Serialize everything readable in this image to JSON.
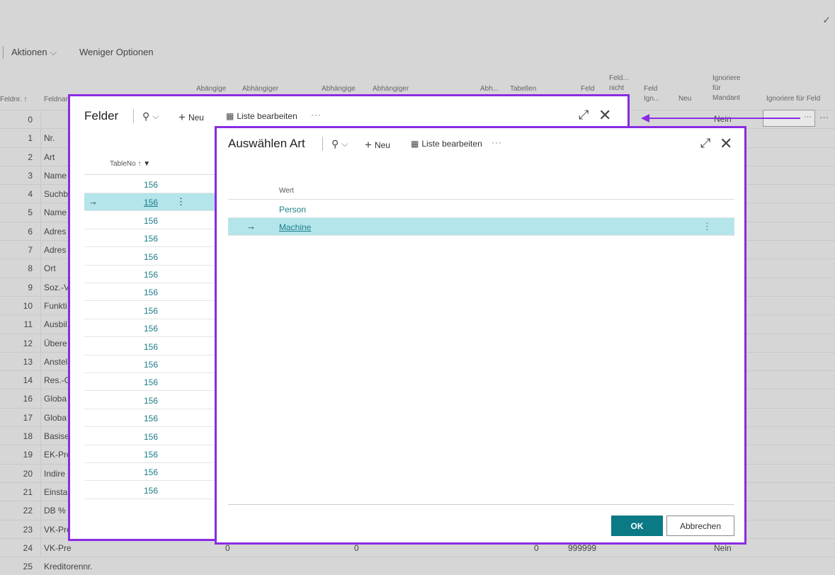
{
  "background_page": {
    "actions": {
      "aktionen": "Aktionen",
      "weniger": "Weniger Optionen"
    },
    "headers": {
      "feldnr": "Feldnr. ↑",
      "feldname": "Feldname",
      "abh1": "Abängige",
      "abh2": "Abhängiger",
      "abh3": "Abhängige",
      "abh4": "Abhängiger",
      "abh5": "Abh...",
      "tabellen": "Tabellen",
      "feld": "Feld",
      "feld_nicht": "Feld... nicht",
      "feld_ign": "Feld Ign...",
      "neu": "Neu",
      "ignoriere_mandant": "Ignoriere für Mandant",
      "ignoriere_feld": "Ignoriere für Feld"
    },
    "rows": [
      {
        "num": "0",
        "name": ""
      },
      {
        "num": "1",
        "name": "Nr."
      },
      {
        "num": "2",
        "name": "Art"
      },
      {
        "num": "3",
        "name": "Name"
      },
      {
        "num": "4",
        "name": "Suchb"
      },
      {
        "num": "5",
        "name": "Name"
      },
      {
        "num": "6",
        "name": "Adres"
      },
      {
        "num": "7",
        "name": "Adres"
      },
      {
        "num": "8",
        "name": "Ort"
      },
      {
        "num": "9",
        "name": "Soz.-V"
      },
      {
        "num": "10",
        "name": "Funkti"
      },
      {
        "num": "11",
        "name": "Ausbil"
      },
      {
        "num": "12",
        "name": "Übere"
      },
      {
        "num": "13",
        "name": "Anstel"
      },
      {
        "num": "14",
        "name": "Res.-G"
      },
      {
        "num": "16",
        "name": "Globa"
      },
      {
        "num": "17",
        "name": "Globa"
      },
      {
        "num": "18",
        "name": "Basise"
      },
      {
        "num": "19",
        "name": "EK-Pre"
      },
      {
        "num": "20",
        "name": "Indire"
      },
      {
        "num": "21",
        "name": "Einsta"
      },
      {
        "num": "22",
        "name": "DB %"
      },
      {
        "num": "23",
        "name": "VK-Pre"
      },
      {
        "num": "24",
        "name": "VK-Pre"
      },
      {
        "num": "25",
        "name": "Kreditorennr."
      }
    ],
    "row0_nein": "Nein",
    "last_row": {
      "v1": "0",
      "v2": "0",
      "v3": "0",
      "v4": "999999",
      "nein": "Nein"
    }
  },
  "felder_dialog": {
    "title": "Felder",
    "new_label": "Neu",
    "edit_list_label": "Liste bearbeiten",
    "column_header": "TableNo ↑",
    "rows": [
      "156",
      "156",
      "156",
      "156",
      "156",
      "156",
      "156",
      "156",
      "156",
      "156",
      "156",
      "156",
      "156",
      "156",
      "156",
      "156",
      "156",
      "156"
    ],
    "selected_index": 1
  },
  "auswahl_dialog": {
    "title": "Auswählen Art",
    "new_label": "Neu",
    "edit_list_label": "Liste bearbeiten",
    "column_header": "Wert",
    "rows": [
      "Person",
      "Machine"
    ],
    "selected_index": 1,
    "ok_label": "OK",
    "cancel_label": "Abbrechen"
  },
  "colors": {
    "accent": "#8a2be2",
    "teal": "#1c7d8a",
    "selection": "#b3e5ea",
    "ok_button": "#0b7a85"
  }
}
